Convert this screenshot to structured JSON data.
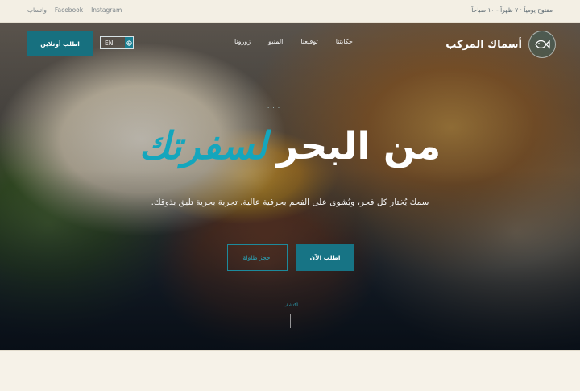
{
  "topbar": {
    "hours": "مفتوح يومياً · ٧ ظهراً - ١٠ صباحاً",
    "social": [
      "واتساب",
      "Facebook",
      "Instagram"
    ]
  },
  "brand": {
    "name": "أسماك المركب",
    "logo_icon": "fish-icon"
  },
  "nav": {
    "items": [
      "حكايتنا",
      "توقيعنا",
      "المنيو",
      "زورونا"
    ]
  },
  "language": {
    "label": "EN"
  },
  "header_cta": {
    "label": "اطلب أونلاين"
  },
  "hero": {
    "kicker": "· · ·",
    "headline_white": "من البحر",
    "headline_teal": "لسفرتك",
    "subtitle": "سمك يُختار كل فجر، ويُشوى على الفحم بحرفية عالية. تجربة بحرية تليق بذوقك.",
    "primary_button": "اطلب الآن",
    "secondary_button": "احجز طاولة",
    "scroll_label": "اكتشف"
  },
  "colors": {
    "accent": "#17707f",
    "teal_text": "#14a6bd",
    "cream": "#f5f1e6"
  }
}
